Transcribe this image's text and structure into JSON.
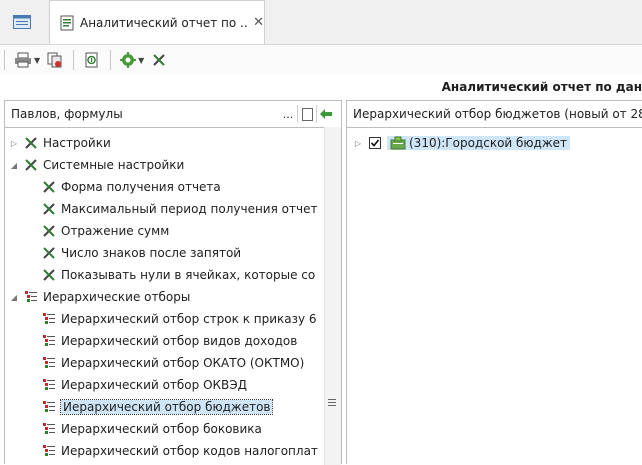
{
  "tabs": {
    "document_title": "Аналитический отчет по ..."
  },
  "report_title": "Аналитический отчет по дан",
  "left_panel": {
    "header": "Павлов, формулы",
    "header_more": "...",
    "items": [
      {
        "label": "Настройки",
        "level": 0,
        "expander": "▷",
        "icon": "tools-icon"
      },
      {
        "label": "Системные настройки",
        "level": 0,
        "expander": "◢",
        "icon": "tools-icon"
      },
      {
        "label": "Форма получения отчета",
        "level": 1,
        "expander": "",
        "icon": "tools-icon"
      },
      {
        "label": "Максимальный период получения отчет",
        "level": 1,
        "expander": "",
        "icon": "tools-icon"
      },
      {
        "label": "Отражение сумм",
        "level": 1,
        "expander": "",
        "icon": "tools-icon"
      },
      {
        "label": "Число знаков после запятой",
        "level": 1,
        "expander": "",
        "icon": "tools-icon"
      },
      {
        "label": "Показывать нули в ячейках, которые со",
        "level": 1,
        "expander": "",
        "icon": "tools-icon"
      },
      {
        "label": "Иерархические отборы",
        "level": 0,
        "expander": "◢",
        "icon": "hierarchy-icon"
      },
      {
        "label": "Иерархический отбор строк к приказу 6",
        "level": 1,
        "expander": "",
        "icon": "hierarchy-icon"
      },
      {
        "label": "Иерархический отбор видов доходов",
        "level": 1,
        "expander": "",
        "icon": "hierarchy-icon"
      },
      {
        "label": "Иерархический отбор ОКАТО (ОКТМО)",
        "level": 1,
        "expander": "",
        "icon": "hierarchy-icon"
      },
      {
        "label": "Иерархический отбор ОКВЭД",
        "level": 1,
        "expander": "",
        "icon": "hierarchy-icon"
      },
      {
        "label": "Иерархический отбор бюджетов",
        "level": 1,
        "expander": "",
        "icon": "hierarchy-icon",
        "selected": true
      },
      {
        "label": "Иерархический отбор боковика",
        "level": 1,
        "expander": "",
        "icon": "hierarchy-icon"
      },
      {
        "label": "Иерархический отбор кодов налогоплат",
        "level": 1,
        "expander": "",
        "icon": "hierarchy-icon"
      }
    ]
  },
  "right_panel": {
    "header": "Иерархический отбор бюджетов (новый от 28",
    "items": [
      {
        "label": "(310):Городской бюджет",
        "checked": true,
        "expander": "▷",
        "icon": "budget-icon"
      }
    ]
  },
  "colors": {
    "selection": "#cfe6f8",
    "accent_green": "#2e7d32",
    "hierarchy_red": "#c62828"
  }
}
